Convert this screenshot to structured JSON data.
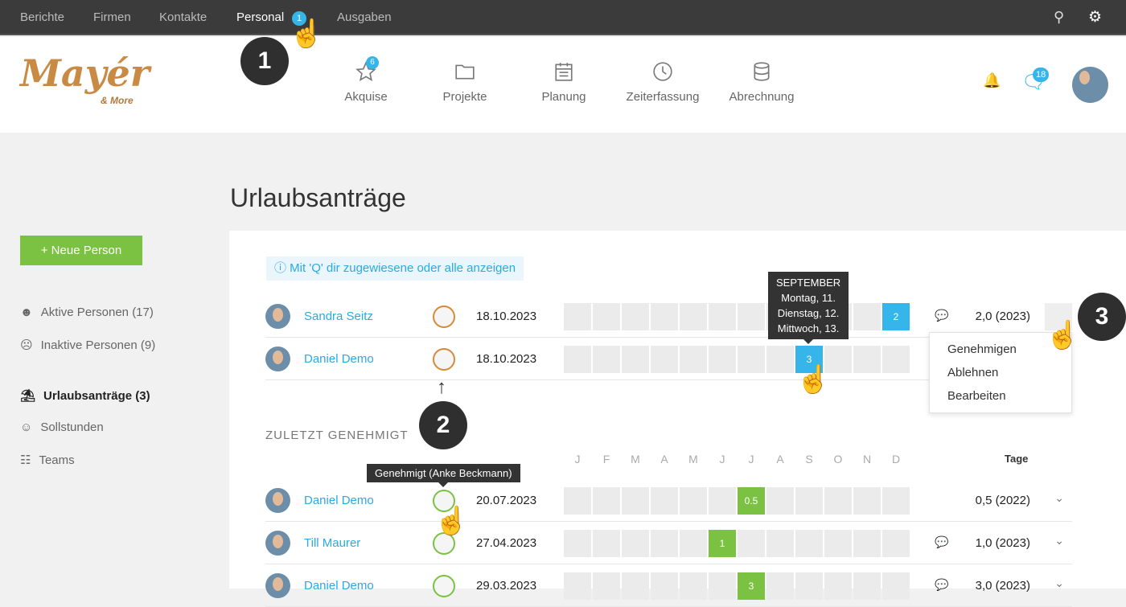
{
  "topnav": {
    "items": [
      "Berichte",
      "Firmen",
      "Kontakte",
      "Personal",
      "Ausgaben"
    ],
    "personal_badge": "1"
  },
  "logo": {
    "name": "Mayér",
    "sub": "& More"
  },
  "mainnav": [
    {
      "label": "Akquise",
      "icon": "star-icon",
      "badge": "6"
    },
    {
      "label": "Projekte",
      "icon": "folder-icon"
    },
    {
      "label": "Planung",
      "icon": "calendar-icon"
    },
    {
      "label": "Zeiterfassung",
      "icon": "clock-icon"
    },
    {
      "label": "Abrechnung",
      "icon": "database-icon"
    }
  ],
  "header": {
    "messages_badge": "18"
  },
  "sidebar": {
    "new_button": "+  Neue Person",
    "items": [
      "Aktive Personen (17)",
      "Inaktive Personen (9)",
      "Urlaubsanträge (3)",
      "Sollstunden",
      "Teams"
    ]
  },
  "page": {
    "title": "Urlaubsanträge",
    "info": "Mit 'Q' dir zugewiesene oder alle anzeigen",
    "section_approved": "ZULETZT GENEHMIGT",
    "days_header": "Tage"
  },
  "months": [
    "J",
    "F",
    "M",
    "A",
    "M",
    "J",
    "J",
    "A",
    "S",
    "O",
    "N",
    "D"
  ],
  "pending": [
    {
      "name": "Sandra Seitz",
      "date": "18.10.2023",
      "month_index": 11,
      "value": "2",
      "comment": true,
      "days": "2,0 (2023)"
    },
    {
      "name": "Daniel Demo",
      "date": "18.10.2023",
      "month_index": 8,
      "value": "3",
      "comment": false,
      "days": ""
    }
  ],
  "approved": [
    {
      "name": "Daniel Demo",
      "date": "20.07.2023",
      "month_index": 6,
      "value": "0.5",
      "comment": false,
      "days": "0,5 (2022)"
    },
    {
      "name": "Till Maurer",
      "date": "27.04.2023",
      "month_index": 5,
      "value": "1",
      "comment": true,
      "days": "1,0 (2023)"
    },
    {
      "name": "Daniel Demo",
      "date": "29.03.2023",
      "month_index": 6,
      "value": "3",
      "comment": true,
      "days": "3,0 (2023)"
    }
  ],
  "tooltip_month": {
    "title": "SEPTEMBER",
    "lines": [
      "Montag, 11.",
      "Dienstag, 12.",
      "Mittwoch, 13."
    ]
  },
  "tooltip_approved": "Genehmigt (Anke Beckmann)",
  "menu": [
    "Genehmigen",
    "Ablehnen",
    "Bearbeiten"
  ],
  "callouts": [
    "1",
    "2",
    "3"
  ],
  "colors": {
    "accent": "#35b5ea",
    "approved": "#7cc242",
    "button": "#7cc242",
    "topbar": "#3b3b3b"
  }
}
